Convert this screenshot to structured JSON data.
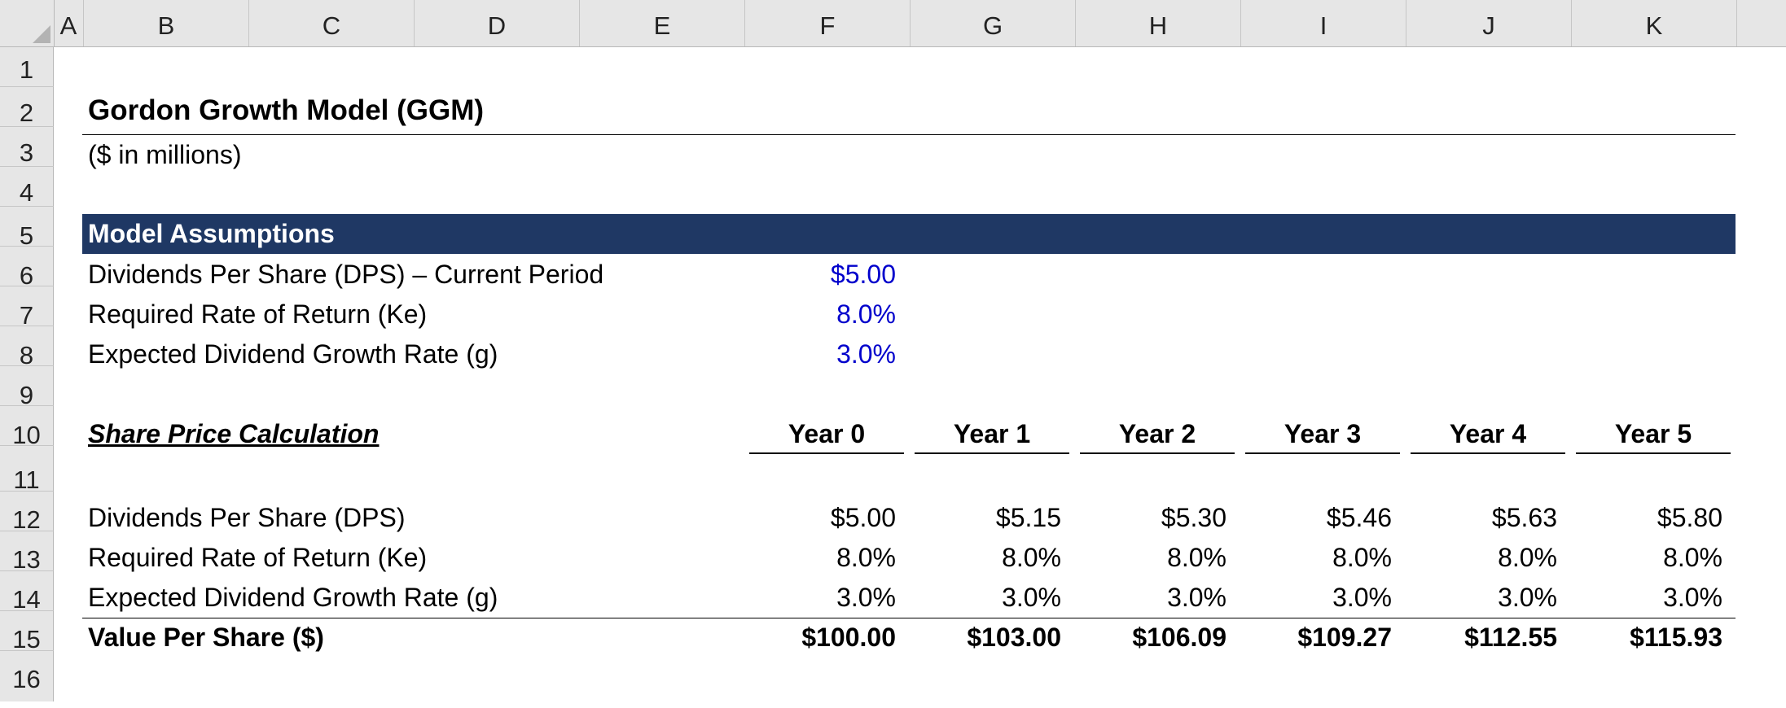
{
  "column_headers": [
    "A",
    "B",
    "C",
    "D",
    "E",
    "F",
    "G",
    "H",
    "I",
    "J",
    "K"
  ],
  "row_headers": [
    "1",
    "2",
    "3",
    "4",
    "5",
    "6",
    "7",
    "8",
    "9",
    "10",
    "11",
    "12",
    "13",
    "14",
    "15",
    "16"
  ],
  "title": "Gordon Growth Model (GGM)",
  "subtitle": "($ in millions)",
  "assumptions": {
    "header": "Model Assumptions",
    "rows": [
      {
        "label": "Dividends Per Share (DPS) – Current Period",
        "value": "$5.00"
      },
      {
        "label": "Required Rate of Return (Ke)",
        "value": "8.0%"
      },
      {
        "label": "Expected Dividend Growth Rate (g)",
        "value": "3.0%"
      }
    ]
  },
  "calculation": {
    "header": "Share Price Calculation",
    "years": [
      "Year 0",
      "Year 1",
      "Year 2",
      "Year 3",
      "Year 4",
      "Year 5"
    ],
    "rows": [
      {
        "label": "Dividends Per Share (DPS)",
        "values": [
          "$5.00",
          "$5.15",
          "$5.30",
          "$5.46",
          "$5.63",
          "$5.80"
        ]
      },
      {
        "label": "Required Rate of Return (Ke)",
        "values": [
          "8.0%",
          "8.0%",
          "8.0%",
          "8.0%",
          "8.0%",
          "8.0%"
        ]
      },
      {
        "label": "Expected Dividend Growth Rate (g)",
        "values": [
          "3.0%",
          "3.0%",
          "3.0%",
          "3.0%",
          "3.0%",
          "3.0%"
        ]
      }
    ],
    "total": {
      "label": "Value Per Share ($)",
      "values": [
        "$100.00",
        "$103.00",
        "$106.09",
        "$109.27",
        "$112.55",
        "$115.93"
      ]
    }
  },
  "colors": {
    "banner": "#1f3864",
    "input_blue": "#0000cc",
    "header_gray": "#e6e6e6"
  }
}
